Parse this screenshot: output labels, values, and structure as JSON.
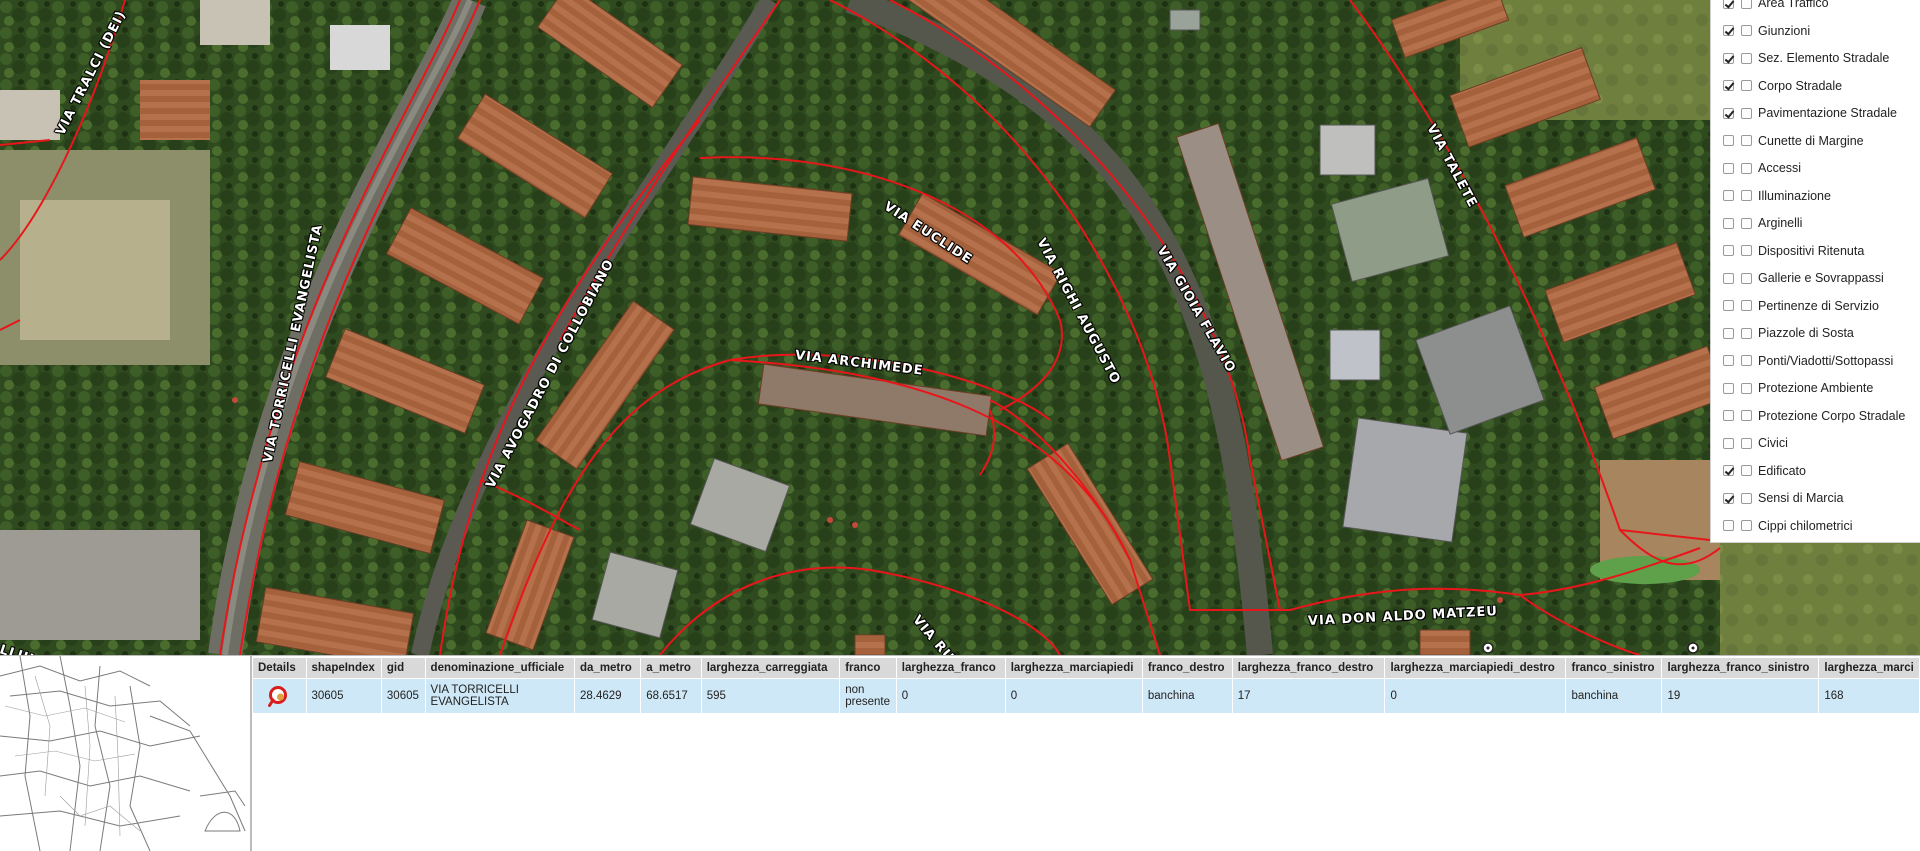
{
  "map": {
    "streets": [
      "VIA TRALCI (DEI)",
      "VIA TORRICELLI EVANGELISTA",
      "VIA AVOGADRO DI COLLOBIANO",
      "VIA EUCLIDE",
      "VIA ARCHIMEDE",
      "VIA RIGHI AUGUSTO",
      "VIA GIOIA FLAVIO",
      "VIA TALETE",
      "VIA DON ALDO MATZEU",
      "VIA RUF",
      "LLULE (DELI"
    ]
  },
  "layers": [
    {
      "label": "Area Traffico",
      "checked": true
    },
    {
      "label": "Giunzioni",
      "checked": true
    },
    {
      "label": "Sez. Elemento Stradale",
      "checked": true
    },
    {
      "label": "Corpo Stradale",
      "checked": true
    },
    {
      "label": "Pavimentazione Stradale",
      "checked": true
    },
    {
      "label": "Cunette di Margine",
      "checked": false
    },
    {
      "label": "Accessi",
      "checked": false
    },
    {
      "label": "Illuminazione",
      "checked": false
    },
    {
      "label": "Arginelli",
      "checked": false
    },
    {
      "label": "Dispositivi Ritenuta",
      "checked": false
    },
    {
      "label": "Gallerie e Sovrappassi",
      "checked": false
    },
    {
      "label": "Pertinenze di Servizio",
      "checked": false
    },
    {
      "label": "Piazzole di Sosta",
      "checked": false
    },
    {
      "label": "Ponti/Viadotti/Sottopassi",
      "checked": false
    },
    {
      "label": "Protezione Ambiente",
      "checked": false
    },
    {
      "label": "Protezione Corpo Stradale",
      "checked": false
    },
    {
      "label": "Civici",
      "checked": false
    },
    {
      "label": "Edificato",
      "checked": true
    },
    {
      "label": "Sensi di Marcia",
      "checked": true
    },
    {
      "label": "Cippi chilometrici",
      "checked": false
    }
  ],
  "grid": {
    "headers": [
      "Details",
      "shapeIndex",
      "gid",
      "denominazione_ufficiale",
      "da_metro",
      "a_metro",
      "larghezza_carreggiata",
      "franco",
      "larghezza_franco",
      "larghezza_marciapiedi",
      "franco_destro",
      "larghezza_franco_destro",
      "larghezza_marciapiedi_destro",
      "franco_sinistro",
      "larghezza_franco_sinistro",
      "larghezza_marci"
    ],
    "row": {
      "shapeIndex": "30605",
      "gid": "30605",
      "denominazione_ufficiale": "VIA TORRICELLI EVANGELISTA",
      "da_metro": "28.4629",
      "a_metro": "68.6517",
      "larghezza_carreggiata": "595",
      "franco": "non presente",
      "larghezza_franco": "0",
      "larghezza_marciapiedi": "0",
      "franco_destro": "banchina",
      "larghezza_franco_destro": "17",
      "larghezza_marciapiedi_destro": "0",
      "franco_sinistro": "banchina",
      "larghezza_franco_sinistro": "19",
      "larghezza_marci": "168"
    }
  },
  "colors": {
    "road_line": "#e8161b",
    "vegetation": "#2f4a1f",
    "roof": "#b06a45",
    "selected_row": "#cfe8f7",
    "header_bg": "#d9d9d9"
  }
}
